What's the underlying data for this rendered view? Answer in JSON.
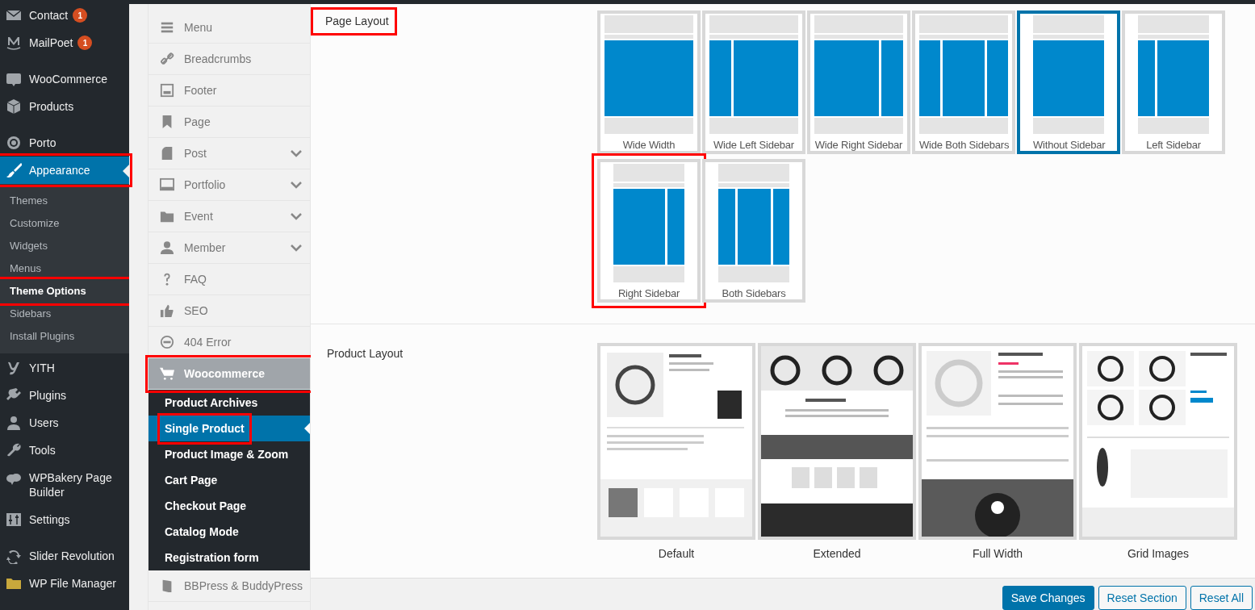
{
  "admin_menu": {
    "groups": [
      [
        {
          "label": "Contact",
          "badge": "1",
          "selected": false
        },
        {
          "label": "MailPoet",
          "badge": "1",
          "selected": false
        }
      ],
      [
        {
          "label": "WooCommerce",
          "selected": false
        },
        {
          "label": "Products",
          "selected": false
        }
      ],
      [
        {
          "label": "Porto",
          "selected": false
        },
        {
          "label": "Appearance",
          "selected": true,
          "highlighted": true,
          "children": [
            {
              "label": "Themes",
              "selected": false
            },
            {
              "label": "Customize",
              "selected": false
            },
            {
              "label": "Widgets",
              "selected": false
            },
            {
              "label": "Menus",
              "selected": false
            },
            {
              "label": "Theme Options",
              "selected": true,
              "highlighted": true
            },
            {
              "label": "Sidebars",
              "selected": false
            },
            {
              "label": "Install Plugins",
              "selected": false
            }
          ]
        },
        {
          "label": "YITH",
          "selected": false
        },
        {
          "label": "Plugins",
          "selected": false
        },
        {
          "label": "Users",
          "selected": false
        },
        {
          "label": "Tools",
          "selected": false
        },
        {
          "label": "WPBakery Page Builder",
          "selected": false
        },
        {
          "label": "Settings",
          "selected": false
        }
      ],
      [
        {
          "label": "Slider Revolution",
          "selected": false
        },
        {
          "label": "WP File Manager",
          "selected": false
        }
      ]
    ]
  },
  "options_sidebar": {
    "items": [
      {
        "label": "Menu",
        "expandable": false,
        "selected": false
      },
      {
        "label": "Breadcrumbs",
        "expandable": false,
        "selected": false
      },
      {
        "label": "Footer",
        "expandable": false,
        "selected": false
      },
      {
        "label": "Page",
        "expandable": false,
        "selected": false
      },
      {
        "label": "Post",
        "expandable": true,
        "selected": false
      },
      {
        "label": "Portfolio",
        "expandable": true,
        "selected": false
      },
      {
        "label": "Event",
        "expandable": true,
        "selected": false
      },
      {
        "label": "Member",
        "expandable": true,
        "selected": false
      },
      {
        "label": "FAQ",
        "expandable": false,
        "selected": false
      },
      {
        "label": "SEO",
        "expandable": false,
        "selected": false
      },
      {
        "label": "404 Error",
        "expandable": false,
        "selected": false
      },
      {
        "label": "Woocommerce",
        "expandable": false,
        "selected": true,
        "highlighted": true,
        "children": [
          {
            "label": "Product Archives",
            "selected": false
          },
          {
            "label": "Single Product",
            "selected": true,
            "highlighted": true
          },
          {
            "label": "Product Image & Zoom",
            "selected": false
          },
          {
            "label": "Cart Page",
            "selected": false
          },
          {
            "label": "Checkout Page",
            "selected": false
          },
          {
            "label": "Catalog Mode",
            "selected": false
          },
          {
            "label": "Registration form",
            "selected": false
          }
        ]
      },
      {
        "label": "BBPress & BuddyPress",
        "expandable": false,
        "selected": false
      }
    ]
  },
  "page_layout": {
    "label": "Page Layout",
    "highlighted": true,
    "options": [
      {
        "label": "Wide Width",
        "wide": true,
        "left_sidebar": false,
        "right_sidebar": false,
        "selected": false
      },
      {
        "label": "Wide Left Sidebar",
        "wide": true,
        "left_sidebar": true,
        "right_sidebar": false,
        "selected": false
      },
      {
        "label": "Wide Right Sidebar",
        "wide": true,
        "left_sidebar": false,
        "right_sidebar": true,
        "selected": false
      },
      {
        "label": "Wide Both Sidebars",
        "wide": true,
        "left_sidebar": true,
        "right_sidebar": true,
        "selected": false
      },
      {
        "label": "Without Sidebar",
        "wide": false,
        "left_sidebar": false,
        "right_sidebar": false,
        "selected": true
      },
      {
        "label": "Left Sidebar",
        "wide": false,
        "left_sidebar": true,
        "right_sidebar": false,
        "selected": false
      },
      {
        "label": "Right Sidebar",
        "wide": false,
        "left_sidebar": false,
        "right_sidebar": true,
        "selected": false,
        "highlighted": true
      },
      {
        "label": "Both Sidebars",
        "wide": false,
        "left_sidebar": true,
        "right_sidebar": true,
        "selected": false
      }
    ]
  },
  "product_layout": {
    "label": "Product Layout",
    "options": [
      {
        "label": "Default",
        "selected": false
      },
      {
        "label": "Extended",
        "selected": false
      },
      {
        "label": "Full Width",
        "selected": false
      },
      {
        "label": "Grid Images",
        "selected": false
      }
    ]
  },
  "footer_buttons": [
    {
      "label": "Save Changes",
      "kind": "primary"
    },
    {
      "label": "Reset Section",
      "kind": "secondary"
    },
    {
      "label": "Reset All",
      "kind": "secondary"
    }
  ]
}
